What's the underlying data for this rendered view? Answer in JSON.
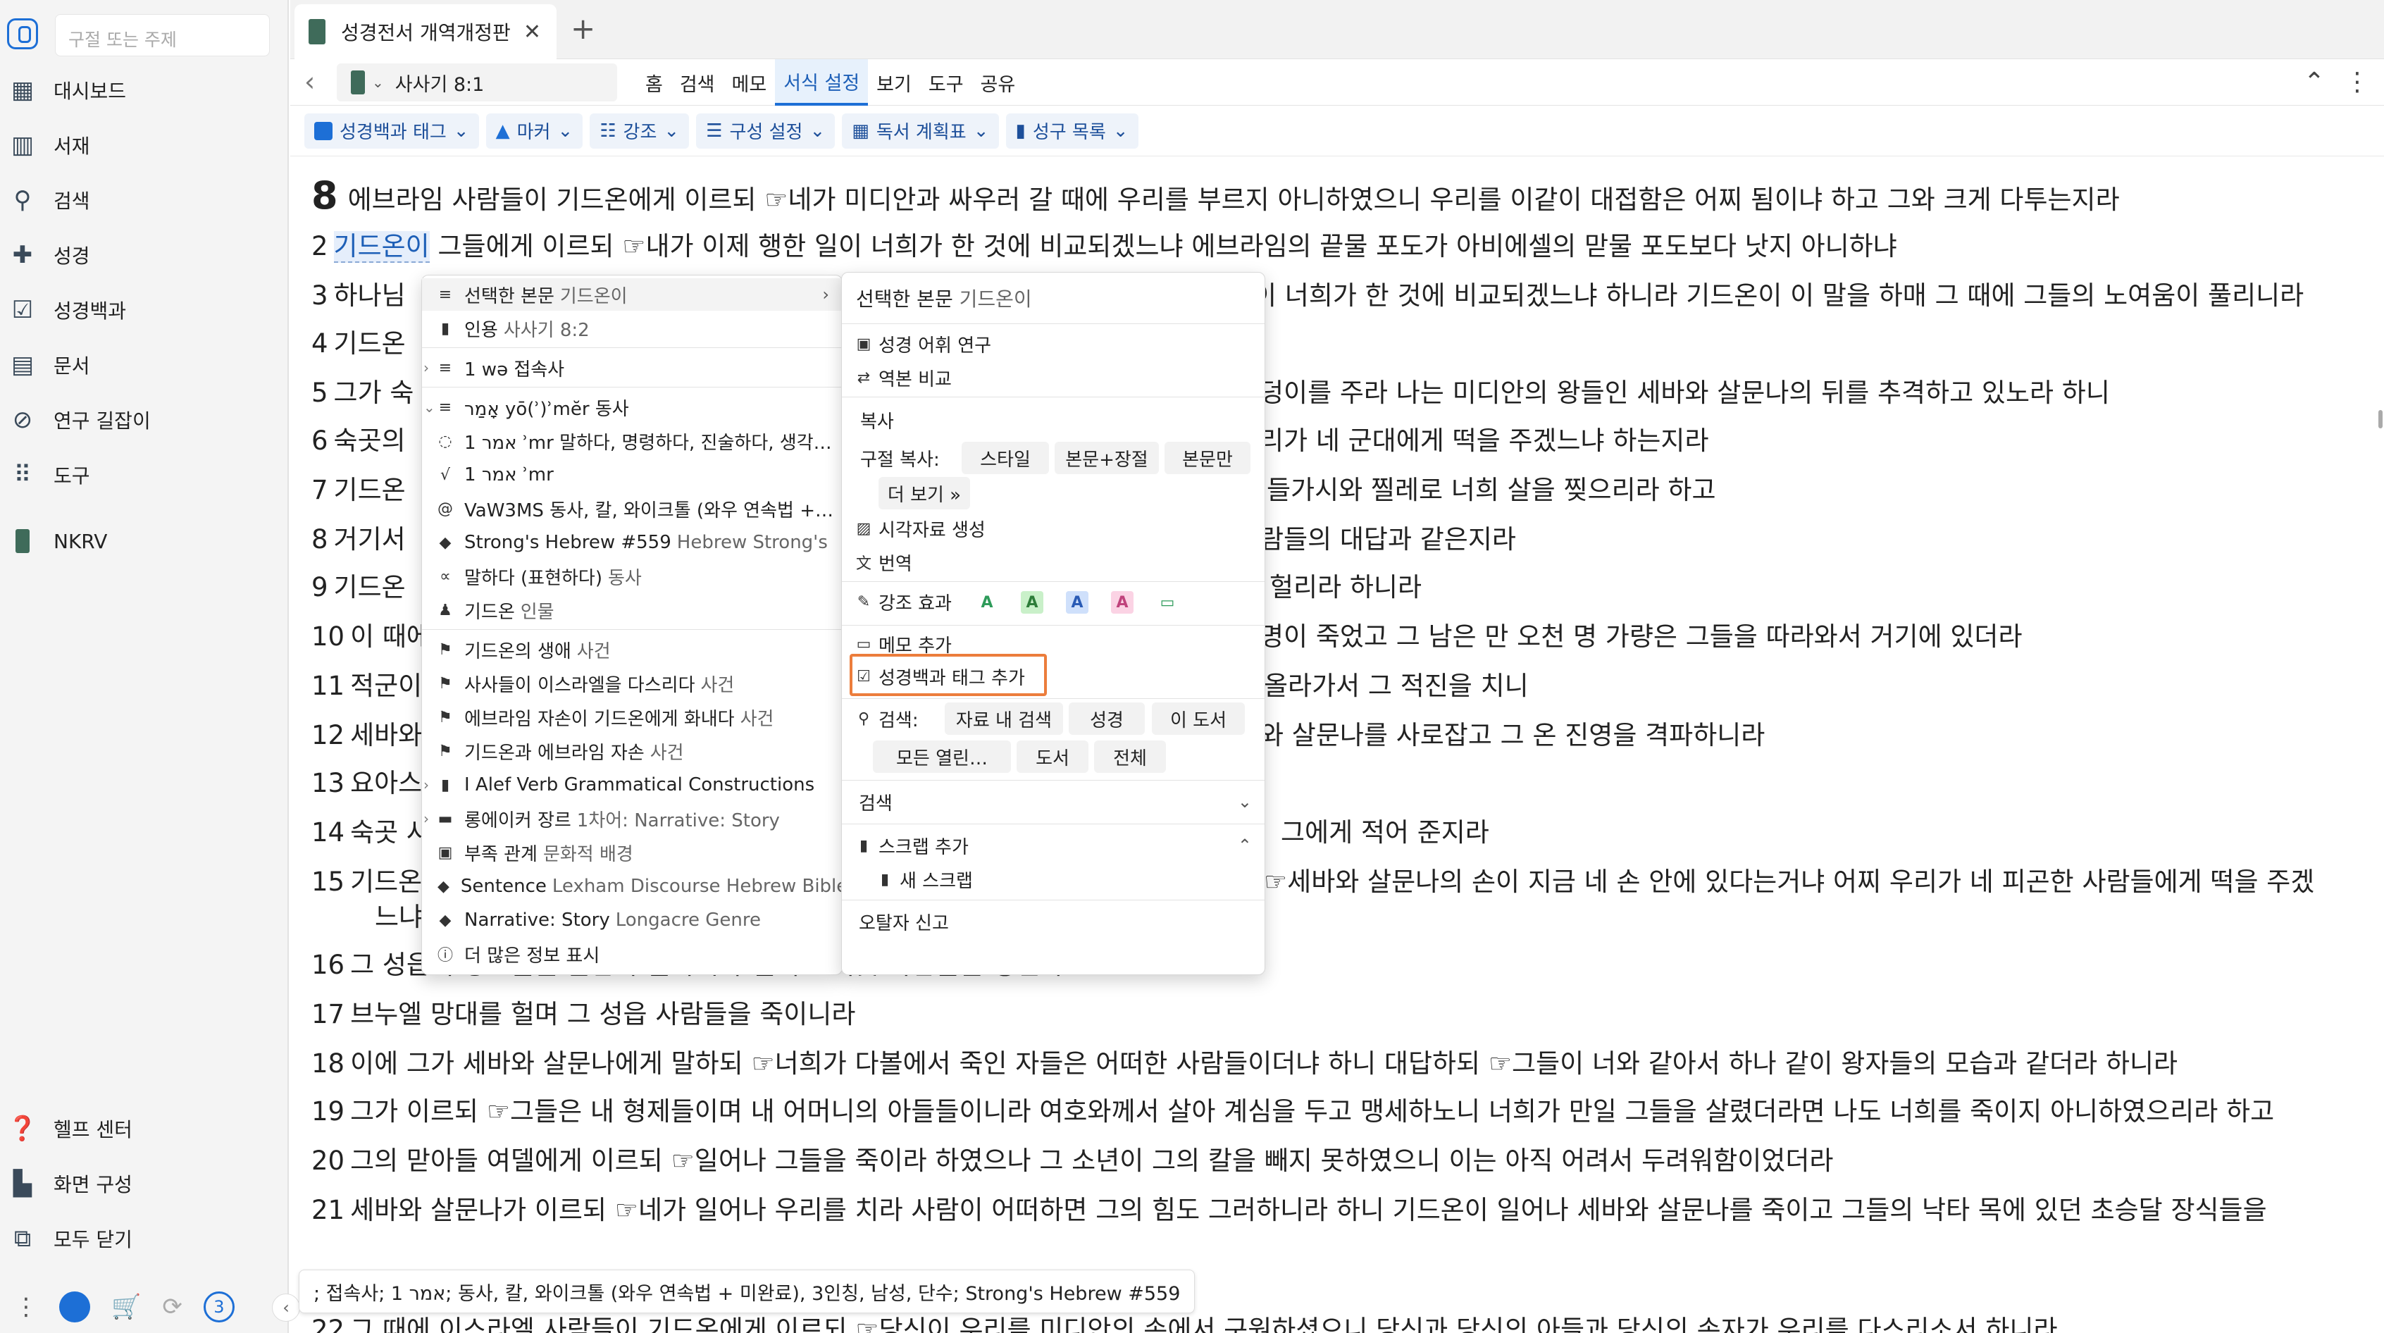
{
  "sidebar": {
    "search_placeholder": "구절 또는 주제",
    "items": [
      {
        "label": "대시보드",
        "icon": "dashboard-icon"
      },
      {
        "label": "서재",
        "icon": "library-icon"
      },
      {
        "label": "검색",
        "icon": "search-icon"
      },
      {
        "label": "성경",
        "icon": "bible-icon"
      },
      {
        "label": "성경백과",
        "icon": "factbook-icon"
      },
      {
        "label": "문서",
        "icon": "document-icon"
      },
      {
        "label": "연구 길잡이",
        "icon": "guide-icon"
      },
      {
        "label": "도구",
        "icon": "tools-icon"
      },
      {
        "label": "NKRV",
        "icon": "book-icon"
      }
    ],
    "bottom": [
      {
        "label": "헬프 센터",
        "icon": "help-icon"
      },
      {
        "label": "화면 구성",
        "icon": "layout-icon"
      },
      {
        "label": "모두 닫기",
        "icon": "close-all-icon"
      }
    ],
    "badge_count": "3"
  },
  "tab": {
    "title": "성경전서 개역개정판"
  },
  "nav": {
    "reference": "사사기 8:1",
    "menu": [
      "홈",
      "검색",
      "메모",
      "서식 설정",
      "보기",
      "도구",
      "공유"
    ],
    "active_menu": "서식 설정"
  },
  "toolbar": [
    "성경백과 태그",
    "마커",
    "강조",
    "구성 설정",
    "독서 계획표",
    "성구 목록"
  ],
  "text": {
    "v1": {
      "chapter": "8",
      "text": "에브라임 사람들이 기드온에게 이르되 ☞네가 미디안과 싸우러 갈 때에 우리를 부르지 아니하였으니 우리를 이같이 대접함은 어찌 됨이냐 하고 그와 크게 다투는지라"
    },
    "v2": {
      "num": "2",
      "selected": "기드온이",
      "text": "그들에게 이르되 ☞내가 이제 행한 일이 너희가 한 것에 비교되겠느냐 에브라임의 끝물 포도가 아비에셀의 맏물 포도보다 낫지 아니하냐"
    },
    "v3": {
      "num": "3",
      "start": "하나님",
      "end": "이 너희가 한 것에 비교되겠느냐 하니라 기드온이 이 말을 하매 그 때에 그들의 노여움이 풀리니라"
    },
    "v4": {
      "num": "4",
      "start": "기드온"
    },
    "v5": {
      "num": "5",
      "start": "그가 숙",
      "end": "덩이를 주라 나는 미디안의 왕들인 세바와 살문나의 뒤를 추격하고 있노라 하니"
    },
    "v6": {
      "num": "6",
      "start": "숙곳의",
      "end": "리가 네 군대에게 떡을 주겠느냐 하는지라"
    },
    "v7": {
      "num": "7",
      "start": "기드온",
      "end": "들가시와 찔레로 너희 살을 찢으리라 하고"
    },
    "v8": {
      "num": "8",
      "start": "거기서",
      "end": "람들의 대답과 같은지라"
    },
    "v9": {
      "num": "9",
      "start": "기드온",
      "end": "헐리라 하니라"
    },
    "v10": {
      "num": "10",
      "start": "이 때에",
      "end": "명이 죽었고 그 남은 만 오천 명 가량은 그들을 따라와서 거기에 있더라"
    },
    "v11": {
      "num": "11",
      "start": "적군이",
      "end": "올라가서 그 적진을 치니"
    },
    "v12": {
      "num": "12",
      "start": "세바와",
      "end": "와 살문나를 사로잡고 그 온 진영을 격파하니라"
    },
    "v13": {
      "num": "13",
      "start": "요아스"
    },
    "v14": {
      "num": "14",
      "start": "숙곳 사",
      "end": "그에게 적어 준지라"
    },
    "v15": {
      "num": "15",
      "start": "기드온",
      "end": "☞세바와 살문나의 손이 지금 네 손 안에 있다는거냐 어찌 우리가 네 피곤한 사람들에게 떡을 주겠",
      "cont": "느냐"
    },
    "v16": {
      "num": "16",
      "text": "그 성읍의 장로들을 붙잡아 들가시와 찔레로 숙곳 사람들을 징벌하고"
    },
    "v17": {
      "num": "17",
      "text": "브누엘 망대를 헐며 그 성읍 사람들을 죽이니라"
    },
    "v18": {
      "num": "18",
      "text": "이에 그가 세바와 살문나에게 말하되 ☞너희가 다볼에서 죽인 자들은 어떠한 사람들이더냐 하니 대답하되 ☞그들이 너와 같아서 하나 같이 왕자들의 모습과 같더라 하니라"
    },
    "v19": {
      "num": "19",
      "text": "그가 이르되 ☞그들은 내 형제들이며 내 어머니의 아들들이니라 여호와께서 살아 계심을 두고 맹세하노니 너희가 만일 그들을 살렸더라면 나도 너희를 죽이지 아니하였으리라 하고"
    },
    "v20": {
      "num": "20",
      "text": "그의 맏아들 여델에게 이르되 ☞일어나 그들을 죽이라 하였으나 그 소년이 그의 칼을 빼지 못하였으니 이는 아직 어려서 두려워함이었더라"
    },
    "v21": {
      "num": "21",
      "text": "세바와 살문나가 이르되 ☞네가 일어나 우리를 치라 사람이 어떠하면 그의 힘도 그러하니라 하니 기드온이 일어나 세바와 살문나를 죽이고 그들의 낙타 목에 있던 초승달 장식들을"
    },
    "v22": {
      "num": "22",
      "text": "그 때에 이스라엘 사람들이 기드온에게 이르되 ☞당신이 우리를 미디안의 손에서 구원하셨으니 당신과 당신의 아들과 당신의 손자가 우리를 다스리소서 하니라"
    }
  },
  "status_tip": "; 접속사; אמר 1; 동사, 칼, 와이크톨 (와우 연속법 + 미완료), 3인칭, 남성, 단수; Strong's Hebrew #559",
  "context_left": [
    {
      "icon": "≡",
      "label": "선택한 본문",
      "sub": "기드온이",
      "arrow": "›"
    },
    {
      "icon": "▮",
      "label": "인용",
      "sub": "사사기 8:2"
    },
    {
      "icon": "≡",
      "label": "1 wə 접속사",
      "sub": "",
      "expand": "›"
    },
    {
      "icon": "≡",
      "label": "אָמַר yō(ʾ)ʾmĕr 동사",
      "sub": "",
      "expand": "⌄"
    },
    {
      "icon": "◌",
      "label": "1 אמר ʾmr 말하다, 명령하다, 진술하다, 생각…",
      "sub": ""
    },
    {
      "icon": "√",
      "label": "1 אמר ʾmr",
      "sub": ""
    },
    {
      "icon": "@",
      "label": "VaW3MS 동사, 칼, 와이크톨 (와우 연속법 +…",
      "sub": ""
    },
    {
      "icon": "◆",
      "label": "Strong's Hebrew #559",
      "sub": "Hebrew Strong's"
    },
    {
      "icon": "∝",
      "label": "말하다 (표현하다)",
      "sub": "동사"
    },
    {
      "icon": "♟",
      "label": "기드온",
      "sub": "인물"
    },
    {
      "icon": "⚑",
      "label": "기드온의 생애",
      "sub": "사건"
    },
    {
      "icon": "⚑",
      "label": "사사들이 이스라엘을 다스리다",
      "sub": "사건"
    },
    {
      "icon": "⚑",
      "label": "에브라임 자손이 기드온에게 화내다",
      "sub": "사건"
    },
    {
      "icon": "⚑",
      "label": "기드온과 에브라임 자손",
      "sub": "사건"
    },
    {
      "icon": "▮",
      "label": "I Alef Verb Grammatical Constructions",
      "sub": "",
      "expand": "›"
    },
    {
      "icon": "▬",
      "label": "롱에이커 장르",
      "sub": "1차어: Narrative: Story",
      "expand": "›"
    },
    {
      "icon": "▣",
      "label": "부족 관계",
      "sub": "문화적 배경"
    },
    {
      "icon": "◆",
      "label": "Sentence",
      "sub": "Lexham Discourse Hebrew Bible"
    },
    {
      "icon": "◆",
      "label": "Narrative: Story",
      "sub": "Longacre Genre"
    },
    {
      "icon": "ⓘ",
      "label": "더 많은 정보 표시",
      "sub": ""
    }
  ],
  "context_right": {
    "header": "선택한 본문",
    "header_sub": "기드온이",
    "items": [
      {
        "icon": "▣",
        "label": "성경 어휘 연구"
      },
      {
        "icon": "⇄",
        "label": "역본 비교"
      }
    ],
    "copy_section": "복사",
    "copy_label": "구절 복사:",
    "copy_buttons": [
      "스타일",
      "본문+장절",
      "본문만",
      "더 보기 »"
    ],
    "visual": "시각자료 생성",
    "translate": "번역",
    "highlight": "강조 효과",
    "swatches": [
      {
        "letter": "A",
        "color": "#2e9b5a",
        "bg": "#ffffff"
      },
      {
        "letter": "A",
        "color": "#2e7d3a",
        "bg": "#c9f0c9"
      },
      {
        "letter": "A",
        "color": "#2a5bb5",
        "bg": "#cfe0fb"
      },
      {
        "letter": "A",
        "color": "#c0437c",
        "bg": "#fbd3e4"
      },
      {
        "letter": "▭",
        "color": "#2e9b5a",
        "bg": "#ffffff"
      }
    ],
    "note": "메모 추가",
    "factbook_tag": "성경백과 태그 추가",
    "search_label": "검색:",
    "search_buttons": [
      "자료 내 검색",
      "성경",
      "이 도서",
      "모든 열린…",
      "도서",
      "전체"
    ],
    "search_section": "검색",
    "scrap_add": "스크랩 추가",
    "new_scrap": "새 스크랩",
    "report": "오탈자 신고"
  },
  "colors": {
    "accent": "#1d6fd6",
    "highlight_box": "#ec7d3c"
  }
}
